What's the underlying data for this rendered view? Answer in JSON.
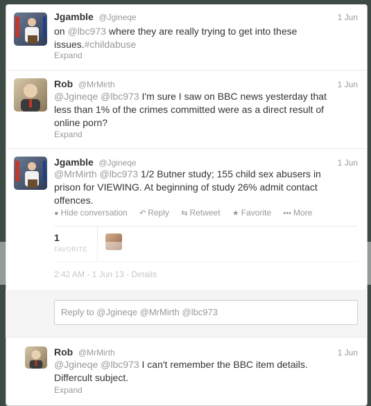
{
  "tweets": [
    {
      "name": "Jgamble",
      "handle": "@Jgineqe",
      "time": "1 Jun",
      "text_pre": "on ",
      "mention1": "@lbc973",
      "text_mid": " where they are really trying to get into these issues.",
      "tag": "#childabuse",
      "expand": "Expand"
    },
    {
      "name": "Rob",
      "handle": "@MrMirth",
      "time": "1 Jun",
      "mention1": "@Jgineqe",
      "mention2": "@lbc973",
      "text": " I'm sure I saw on BBC news yesterday that less than 1% of the crimes committed were as a direct result of online porn?",
      "expand": "Expand"
    },
    {
      "name": "Jgamble",
      "handle": "@Jgineqe",
      "time": "1 Jun",
      "mention1": "@MrMirth",
      "mention2": "@lbc973",
      "text": " 1/2 Butner study; 155 child sex abusers in prison for VIEWING. At beginning of study 26% admit contact offences.",
      "actions": {
        "hide": "Hide conversation",
        "reply": "Reply",
        "retweet": "Retweet",
        "favorite": "Favorite",
        "more": "More"
      },
      "favorites_count": "1",
      "favorites_label": "FAVORITE",
      "meta": "2:42 AM - 1 Jun 13 · Details"
    },
    {
      "name": "Rob",
      "handle": "@MrMirth",
      "time": "1 Jun",
      "mention1": "@Jgineqe",
      "mention2": "@lbc973",
      "text": " I can't remember the BBC item details. Differcult subject.",
      "expand": "Expand"
    }
  ],
  "reply_box": {
    "placeholder": "Reply to @Jgineqe @MrMirth @lbc973"
  }
}
